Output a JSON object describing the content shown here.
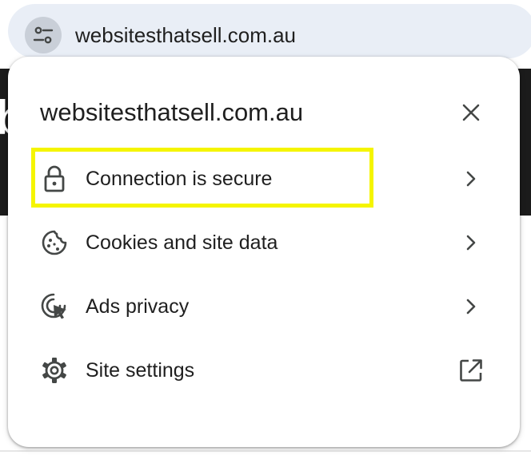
{
  "address_bar": {
    "url": "websitesthatsell.com.au",
    "site_info_icon": "tune-icon"
  },
  "popup": {
    "title": "websitesthatsell.com.au",
    "close_icon": "close-icon",
    "items": [
      {
        "label": "Connection is secure",
        "icon": "lock-icon",
        "trailing_icon": "chevron-right-icon",
        "highlighted": true
      },
      {
        "label": "Cookies and site data",
        "icon": "cookie-icon",
        "trailing_icon": "chevron-right-icon"
      },
      {
        "label": "Ads privacy",
        "icon": "ads-privacy-icon",
        "trailing_icon": "chevron-right-icon"
      },
      {
        "label": "Site settings",
        "icon": "gear-icon",
        "trailing_icon": "open-in-new-icon"
      }
    ]
  },
  "colors": {
    "highlight": "#f5f500",
    "omnibox_bg": "#e9eef6",
    "icon": "#444746",
    "text": "#1f1f1f"
  }
}
